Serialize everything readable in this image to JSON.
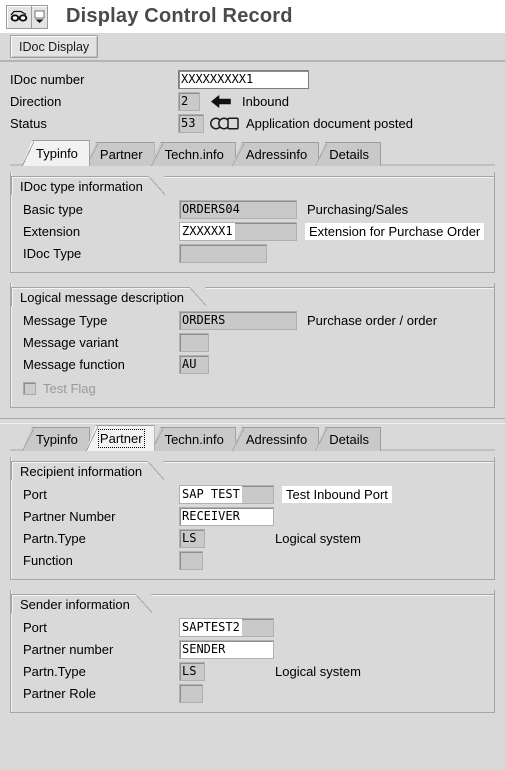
{
  "window": {
    "title": "Display Control Record",
    "system_icon": "display-glasses-icon",
    "menu_arrow_icon": "dropdown-arrow-icon"
  },
  "toolbar": {
    "idoc_display_label": "IDoc Display"
  },
  "header": {
    "idoc_number": {
      "label": "IDoc number",
      "value": "XXXXXXXXX1"
    },
    "direction": {
      "label": "Direction",
      "value": "2",
      "icon": "arrow-left-inbound-icon",
      "description": "Inbound"
    },
    "status": {
      "label": "Status",
      "value": "53",
      "icon": "traffic-light-icon",
      "description": "Application document posted"
    }
  },
  "tabs_top": [
    {
      "label": "Typinfo",
      "active": true,
      "focused": false
    },
    {
      "label": "Partner",
      "active": false,
      "focused": false
    },
    {
      "label": "Techn.info",
      "active": false,
      "focused": false
    },
    {
      "label": "Adressinfo",
      "active": false,
      "focused": false
    },
    {
      "label": "Details",
      "active": false,
      "focused": false
    }
  ],
  "tabs_bottom": [
    {
      "label": "Typinfo",
      "active": false,
      "focused": false
    },
    {
      "label": "Partner",
      "active": true,
      "focused": true
    },
    {
      "label": "Techn.info",
      "active": false,
      "focused": false
    },
    {
      "label": "Adressinfo",
      "active": false,
      "focused": false
    },
    {
      "label": "Details",
      "active": false,
      "focused": false
    }
  ],
  "idoc_type_information": {
    "title": "IDoc type information",
    "basic_type": {
      "label": "Basic type",
      "value": "ORDERS04",
      "description": "Purchasing/Sales"
    },
    "extension": {
      "label": "Extension",
      "value": "ZXXXXX1",
      "description": "Extension for Purchase Order"
    },
    "idoc_type": {
      "label": "IDoc Type",
      "value": ""
    }
  },
  "logical_message_description": {
    "title": "Logical message description",
    "message_type": {
      "label": "Message Type",
      "value": "ORDERS",
      "description": "Purchase order / order"
    },
    "message_variant": {
      "label": "Message variant",
      "value": ""
    },
    "message_function": {
      "label": "Message function",
      "value": "AU"
    },
    "test_flag": {
      "label": "Test Flag",
      "checked": false,
      "disabled": true
    }
  },
  "recipient_information": {
    "title": "Recipient information",
    "port": {
      "label": "Port",
      "value": "SAP TEST",
      "description": "Test Inbound Port"
    },
    "partner_number": {
      "label": "Partner Number",
      "value": "RECEIVER"
    },
    "partner_type": {
      "label": "Partn.Type",
      "value": "LS",
      "description": "Logical system"
    },
    "function": {
      "label": "Function",
      "value": ""
    }
  },
  "sender_information": {
    "title": "Sender information",
    "port": {
      "label": "Port",
      "value": "SAPTEST2"
    },
    "partner_number": {
      "label": "Partner number",
      "value": "SENDER"
    },
    "partner_type": {
      "label": "Partn.Type",
      "value": "LS",
      "description": "Logical system"
    },
    "partner_role": {
      "label": "Partner Role",
      "value": ""
    }
  },
  "colors": {
    "window_background": "#d9d9d9",
    "field_background": "#c9c9c9",
    "input_background": "#ffffff",
    "active_tab": "#f2f2f2",
    "inactive_tab": "#c9c9c9",
    "title_text": "#4a4a4a"
  }
}
